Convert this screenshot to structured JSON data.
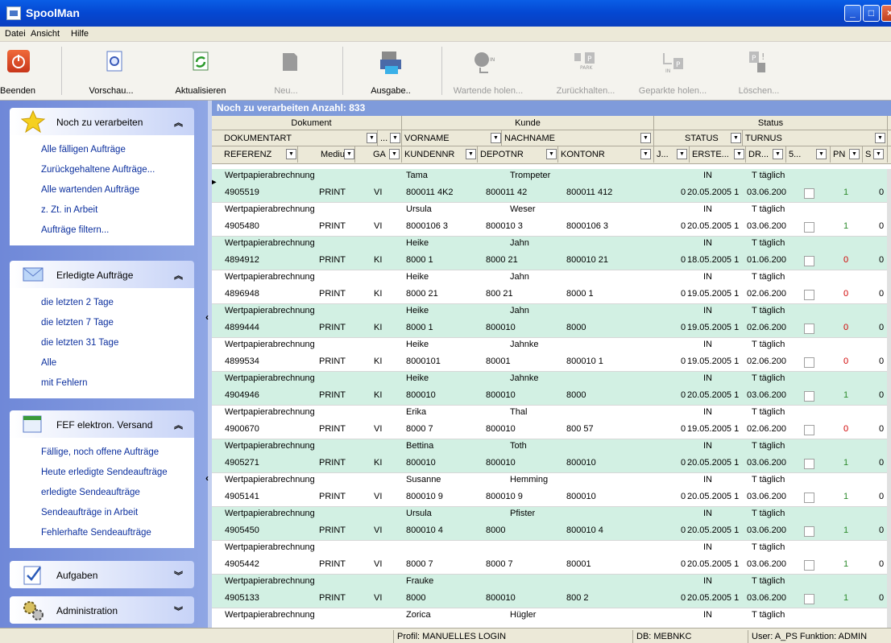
{
  "window": {
    "title": "SpoolMan"
  },
  "menu": [
    "Datei",
    "Ansicht",
    "Hilfe"
  ],
  "toolbar": [
    {
      "label": "Beenden",
      "icon": "power-icon",
      "enabled": true
    },
    {
      "label": "Vorschau...",
      "icon": "preview-icon",
      "enabled": true
    },
    {
      "label": "Aktualisieren",
      "icon": "refresh-icon",
      "enabled": true
    },
    {
      "label": "Neu...",
      "icon": "new-document-icon",
      "enabled": false
    },
    {
      "label": "Ausgabe..",
      "icon": "printer-icon",
      "enabled": true
    },
    {
      "label": "Wartende holen...",
      "icon": "fetch-waiting-icon",
      "enabled": false
    },
    {
      "label": "Zurückhalten...",
      "icon": "park-icon",
      "enabled": false
    },
    {
      "label": "Geparkte holen...",
      "icon": "fetch-parked-icon",
      "enabled": false
    },
    {
      "label": "Löschen...",
      "icon": "delete-icon",
      "enabled": false
    }
  ],
  "sidebar": {
    "groups": [
      {
        "title": "Noch zu verarbeiten",
        "icon": "star-icon",
        "expanded": true,
        "items": [
          "Alle fälligen Aufträge",
          "Zurückgehaltene Aufträge...",
          "Alle wartenden Aufträge",
          "z. Zt. in Arbeit",
          "Aufträge filtern..."
        ]
      },
      {
        "title": "Erledigte Aufträge",
        "icon": "envelope-icon",
        "expanded": true,
        "items": [
          "die letzten 2 Tage",
          "die letzten 7 Tage",
          "die letzten 31 Tage",
          "Alle",
          "mit Fehlern"
        ]
      },
      {
        "title": "FEF elektron. Versand",
        "icon": "folder-send-icon",
        "expanded": true,
        "items": [
          "Fällige, noch offene Aufträge",
          "Heute erledigte Sendeaufträge",
          "erledigte Sendeaufträge",
          "Sendeaufträge in Arbeit",
          "Fehlerhafte Sendeaufträge"
        ]
      },
      {
        "title": "Aufgaben",
        "icon": "tasks-icon",
        "expanded": false,
        "items": []
      },
      {
        "title": "Administration",
        "icon": "gears-icon",
        "expanded": false,
        "items": []
      }
    ]
  },
  "grid": {
    "caption": "Noch zu verarbeiten   Anzahl: 833",
    "bands": [
      "Dokument",
      "Kunde",
      "Status"
    ],
    "header1": [
      "DOKUMENTART",
      "...",
      "VORNAME",
      "NACHNAME",
      "STATUS",
      "TURNUS"
    ],
    "header2": [
      "REFERENZ",
      "Medium",
      "GA",
      "KUNDENNR",
      "DEPOTNR",
      "KONTONR",
      "J...",
      "ERSTE...",
      "DR...",
      "5...",
      "PN",
      "S"
    ],
    "rows": [
      {
        "doc": "Wertpapierabrechnung",
        "ref": "4905519",
        "medium": "PRINT",
        "ga": "VI",
        "vorname": "Tama",
        "nachname": "Trompeter",
        "kundennr": "800011 4K2",
        "depotnr": "800011 42",
        "kontonr": "800011 412",
        "status": "IN",
        "turnus": "T täglich",
        "j": "0",
        "erste": "20.05.2005 1",
        "dr": "03.06.200",
        "pn": "1",
        "s": "0"
      },
      {
        "doc": "Wertpapierabrechnung",
        "ref": "4905480",
        "medium": "PRINT",
        "ga": "VI",
        "vorname": "Ursula",
        "nachname": "Weser",
        "kundennr": "8000106 3",
        "depotnr": "800010 3",
        "kontonr": "8000106 3",
        "status": "IN",
        "turnus": "T täglich",
        "j": "0",
        "erste": "20.05.2005 1",
        "dr": "03.06.200",
        "pn": "1",
        "s": "0"
      },
      {
        "doc": "Wertpapierabrechnung",
        "ref": "4894912",
        "medium": "PRINT",
        "ga": "KI",
        "vorname": "Heike",
        "nachname": "Jahn",
        "kundennr": "8000 1",
        "depotnr": "8000 21",
        "kontonr": "800010 21",
        "status": "IN",
        "turnus": "T täglich",
        "j": "0",
        "erste": "18.05.2005 1",
        "dr": "01.06.200",
        "pn": "0",
        "s": "0"
      },
      {
        "doc": "Wertpapierabrechnung",
        "ref": "4896948",
        "medium": "PRINT",
        "ga": "KI",
        "vorname": "Heike",
        "nachname": "Jahn",
        "kundennr": "8000 21",
        "depotnr": "800 21",
        "kontonr": "8000 1",
        "status": "IN",
        "turnus": "T täglich",
        "j": "0",
        "erste": "19.05.2005 1",
        "dr": "02.06.200",
        "pn": "0",
        "s": "0"
      },
      {
        "doc": "Wertpapierabrechnung",
        "ref": "4899444",
        "medium": "PRINT",
        "ga": "KI",
        "vorname": "Heike",
        "nachname": "Jahn",
        "kundennr": "8000 1",
        "depotnr": "800010",
        "kontonr": "8000",
        "status": "IN",
        "turnus": "T täglich",
        "j": "0",
        "erste": "19.05.2005 1",
        "dr": "02.06.200",
        "pn": "0",
        "s": "0"
      },
      {
        "doc": "Wertpapierabrechnung",
        "ref": "4899534",
        "medium": "PRINT",
        "ga": "KI",
        "vorname": "Heike",
        "nachname": "Jahnke",
        "kundennr": "8000101",
        "depotnr": "80001",
        "kontonr": "800010 1",
        "status": "IN",
        "turnus": "T täglich",
        "j": "0",
        "erste": "19.05.2005 1",
        "dr": "02.06.200",
        "pn": "0",
        "s": "0"
      },
      {
        "doc": "Wertpapierabrechnung",
        "ref": "4904946",
        "medium": "PRINT",
        "ga": "KI",
        "vorname": "Heike",
        "nachname": "Jahnke",
        "kundennr": "800010",
        "depotnr": "800010",
        "kontonr": "8000",
        "status": "IN",
        "turnus": "T täglich",
        "j": "0",
        "erste": "20.05.2005 1",
        "dr": "03.06.200",
        "pn": "1",
        "s": "0"
      },
      {
        "doc": "Wertpapierabrechnung",
        "ref": "4900670",
        "medium": "PRINT",
        "ga": "VI",
        "vorname": "Erika",
        "nachname": "Thal",
        "kundennr": "8000 7",
        "depotnr": "800010",
        "kontonr": "800 57",
        "status": "IN",
        "turnus": "T täglich",
        "j": "0",
        "erste": "19.05.2005 1",
        "dr": "02.06.200",
        "pn": "0",
        "s": "0"
      },
      {
        "doc": "Wertpapierabrechnung",
        "ref": "4905271",
        "medium": "PRINT",
        "ga": "KI",
        "vorname": "Bettina",
        "nachname": "Toth",
        "kundennr": "800010",
        "depotnr": "800010",
        "kontonr": "800010",
        "status": "IN",
        "turnus": "T täglich",
        "j": "0",
        "erste": "20.05.2005 1",
        "dr": "03.06.200",
        "pn": "1",
        "s": "0"
      },
      {
        "doc": "Wertpapierabrechnung",
        "ref": "4905141",
        "medium": "PRINT",
        "ga": "VI",
        "vorname": "Susanne",
        "nachname": "Hemming",
        "kundennr": "800010 9",
        "depotnr": "800010 9",
        "kontonr": "800010",
        "status": "IN",
        "turnus": "T täglich",
        "j": "0",
        "erste": "20.05.2005 1",
        "dr": "03.06.200",
        "pn": "1",
        "s": "0"
      },
      {
        "doc": "Wertpapierabrechnung",
        "ref": "4905450",
        "medium": "PRINT",
        "ga": "VI",
        "vorname": "Ursula",
        "nachname": "Pfister",
        "kundennr": "800010 4",
        "depotnr": "8000",
        "kontonr": "800010 4",
        "status": "IN",
        "turnus": "T täglich",
        "j": "0",
        "erste": "20.05.2005 1",
        "dr": "03.06.200",
        "pn": "1",
        "s": "0"
      },
      {
        "doc": "Wertpapierabrechnung",
        "ref": "4905442",
        "medium": "PRINT",
        "ga": "VI",
        "vorname": "",
        "nachname": "",
        "kundennr": "8000 7",
        "depotnr": "8000 7",
        "kontonr": "80001",
        "status": "IN",
        "turnus": "T täglich",
        "j": "0",
        "erste": "20.05.2005 1",
        "dr": "03.06.200",
        "pn": "1",
        "s": "0"
      },
      {
        "doc": "Wertpapierabrechnung",
        "ref": "4905133",
        "medium": "PRINT",
        "ga": "VI",
        "vorname": "Frauke",
        "nachname": "",
        "kundennr": "8000",
        "depotnr": "800010",
        "kontonr": "800 2",
        "status": "IN",
        "turnus": "T täglich",
        "j": "0",
        "erste": "20.05.2005 1",
        "dr": "03.06.200",
        "pn": "1",
        "s": "0"
      },
      {
        "doc": "Wertpapierabrechnung",
        "ref": "",
        "medium": "",
        "ga": "",
        "vorname": "Zorica",
        "nachname": "Hügler",
        "kundennr": "",
        "depotnr": "",
        "kontonr": "",
        "status": "IN",
        "turnus": "T täglich",
        "j": "",
        "erste": "",
        "dr": "",
        "pn": "",
        "s": ""
      }
    ]
  },
  "statusbar": {
    "profil": "Profil: MANUELLES LOGIN",
    "db": "DB: MEBNKC",
    "user": "User: A_PS Funktion: ADMIN"
  },
  "colors": {
    "titlebar": "#0447d1",
    "sidebar": "#7f96dc",
    "rowAlt": "#d2f0e3",
    "link": "#0b2f9e"
  }
}
